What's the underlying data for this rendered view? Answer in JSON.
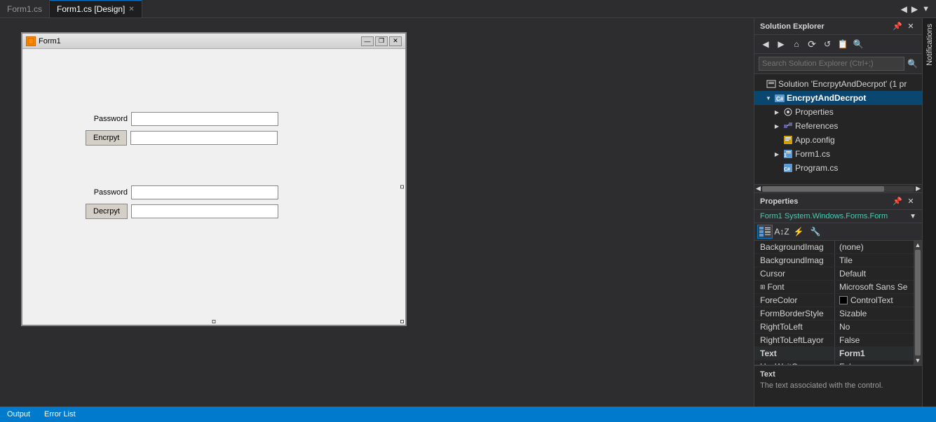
{
  "tabs": [
    {
      "id": "form1cs",
      "label": "Form1.cs",
      "active": false,
      "closable": false
    },
    {
      "id": "form1design",
      "label": "Form1.cs [Design]",
      "active": true,
      "closable": true
    }
  ],
  "form": {
    "title": "Form1",
    "password_label_1": "Password",
    "encrypt_button": "Encrpyt",
    "password_label_2": "Password",
    "decrypt_button": "Decrpyt",
    "controls": {
      "minimize": "—",
      "restore": "❐",
      "close": "✕"
    }
  },
  "solution_explorer": {
    "title": "Solution Explorer",
    "search_placeholder": "Search Solution Explorer (Ctrl+;)",
    "toolbar_icons": [
      "←",
      "→",
      "🏠",
      "⟳",
      "↻",
      "📋",
      "🔍"
    ],
    "tree": [
      {
        "level": 0,
        "label": "Solution 'EncrpytAndDecrpot' (1 pr",
        "arrow": "",
        "icon": "📄",
        "bold": false
      },
      {
        "level": 1,
        "label": "EncrpytAndDecrpot",
        "arrow": "▼",
        "icon": "C#",
        "bold": true
      },
      {
        "level": 2,
        "label": "Properties",
        "arrow": "▶",
        "icon": "🔧"
      },
      {
        "level": 2,
        "label": "References",
        "arrow": "▶",
        "icon": "📦"
      },
      {
        "level": 2,
        "label": "App.config",
        "arrow": "",
        "icon": "⚙"
      },
      {
        "level": 2,
        "label": "Form1.cs",
        "arrow": "▶",
        "icon": "📄"
      },
      {
        "level": 2,
        "label": "Program.cs",
        "arrow": "",
        "icon": "C#"
      }
    ]
  },
  "properties_panel": {
    "title": "Properties",
    "subject": "Form1",
    "subject_type": "System.Windows.Forms.Form",
    "toolbar_buttons": [
      "≡≡",
      "⚡",
      "🖊",
      "🔧"
    ],
    "rows": [
      {
        "name": "BackgroundImag",
        "value": "(none)",
        "expand": false,
        "color": null
      },
      {
        "name": "BackgroundImag",
        "value": "Tile",
        "expand": false,
        "color": null
      },
      {
        "name": "Cursor",
        "value": "Default",
        "expand": false,
        "color": null
      },
      {
        "name": "Font",
        "value": "Microsoft Sans Se",
        "expand": true,
        "color": null
      },
      {
        "name": "ForeColor",
        "value": "ControlText",
        "expand": false,
        "color": "#000000"
      },
      {
        "name": "FormBorderStyle",
        "value": "Sizable",
        "expand": false,
        "color": null
      },
      {
        "name": "RightToLeft",
        "value": "No",
        "expand": false,
        "color": null
      },
      {
        "name": "RightToLeftLayor",
        "value": "False",
        "expand": false,
        "color": null
      },
      {
        "name": "Text",
        "value": "Form1",
        "expand": false,
        "color": null,
        "bold_value": true
      },
      {
        "name": "UseWaitCursor",
        "value": "False",
        "expand": false,
        "color": null
      }
    ],
    "description_title": "Text",
    "description_text": "The text associated with the control."
  },
  "status_bar": {
    "items": [
      "Output",
      "Error List"
    ]
  },
  "notifications": {
    "label": "Notifications"
  }
}
